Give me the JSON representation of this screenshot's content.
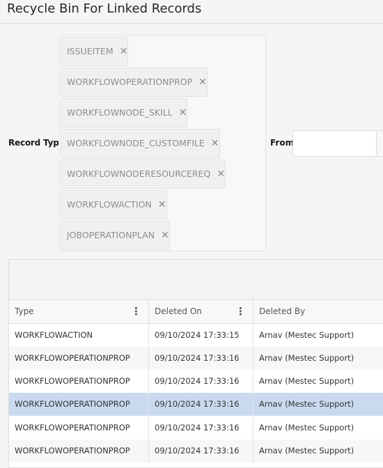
{
  "window": {
    "title": "Recycle Bin For Linked Records"
  },
  "filters": {
    "record_type_label": "Record Type",
    "record_types": [
      "ISSUEITEM",
      "WORKFLOWOPERATIONPROP",
      "WORKFLOWNODE_SKILL",
      "WORKFLOWNODE_CUSTOMFILE",
      "WORKFLOWNODERESOURCEREQ",
      "WORKFLOWACTION",
      "JOBOPERATIONPLAN"
    ],
    "remove_icon": "close-icon",
    "from_label": "From",
    "from_value": "",
    "from_icon": "calendar-icon"
  },
  "grid": {
    "columns": [
      "Type",
      "Deleted On",
      "Deleted By"
    ],
    "column_menu_icon": "vertical-ellipsis-icon",
    "rows": [
      [
        "WORKFLOWACTION",
        "09/10/2024 17:33:15",
        "Arnav (Mestec Support)"
      ],
      [
        "WORKFLOWOPERATIONPROP",
        "09/10/2024 17:33:16",
        "Arnav (Mestec Support)"
      ],
      [
        "WORKFLOWOPERATIONPROP",
        "09/10/2024 17:33:16",
        "Arnav (Mestec Support)"
      ],
      [
        "WORKFLOWOPERATIONPROP",
        "09/10/2024 17:33:16",
        "Arnav (Mestec Support)"
      ],
      [
        "WORKFLOWOPERATIONPROP",
        "09/10/2024 17:33:16",
        "Arnav (Mestec Support)"
      ],
      [
        "WORKFLOWOPERATIONPROP",
        "09/10/2024 17:33:16",
        "Arnav (Mestec Support)"
      ]
    ],
    "selected_row": 3,
    "selection_color": "#c9daef"
  }
}
